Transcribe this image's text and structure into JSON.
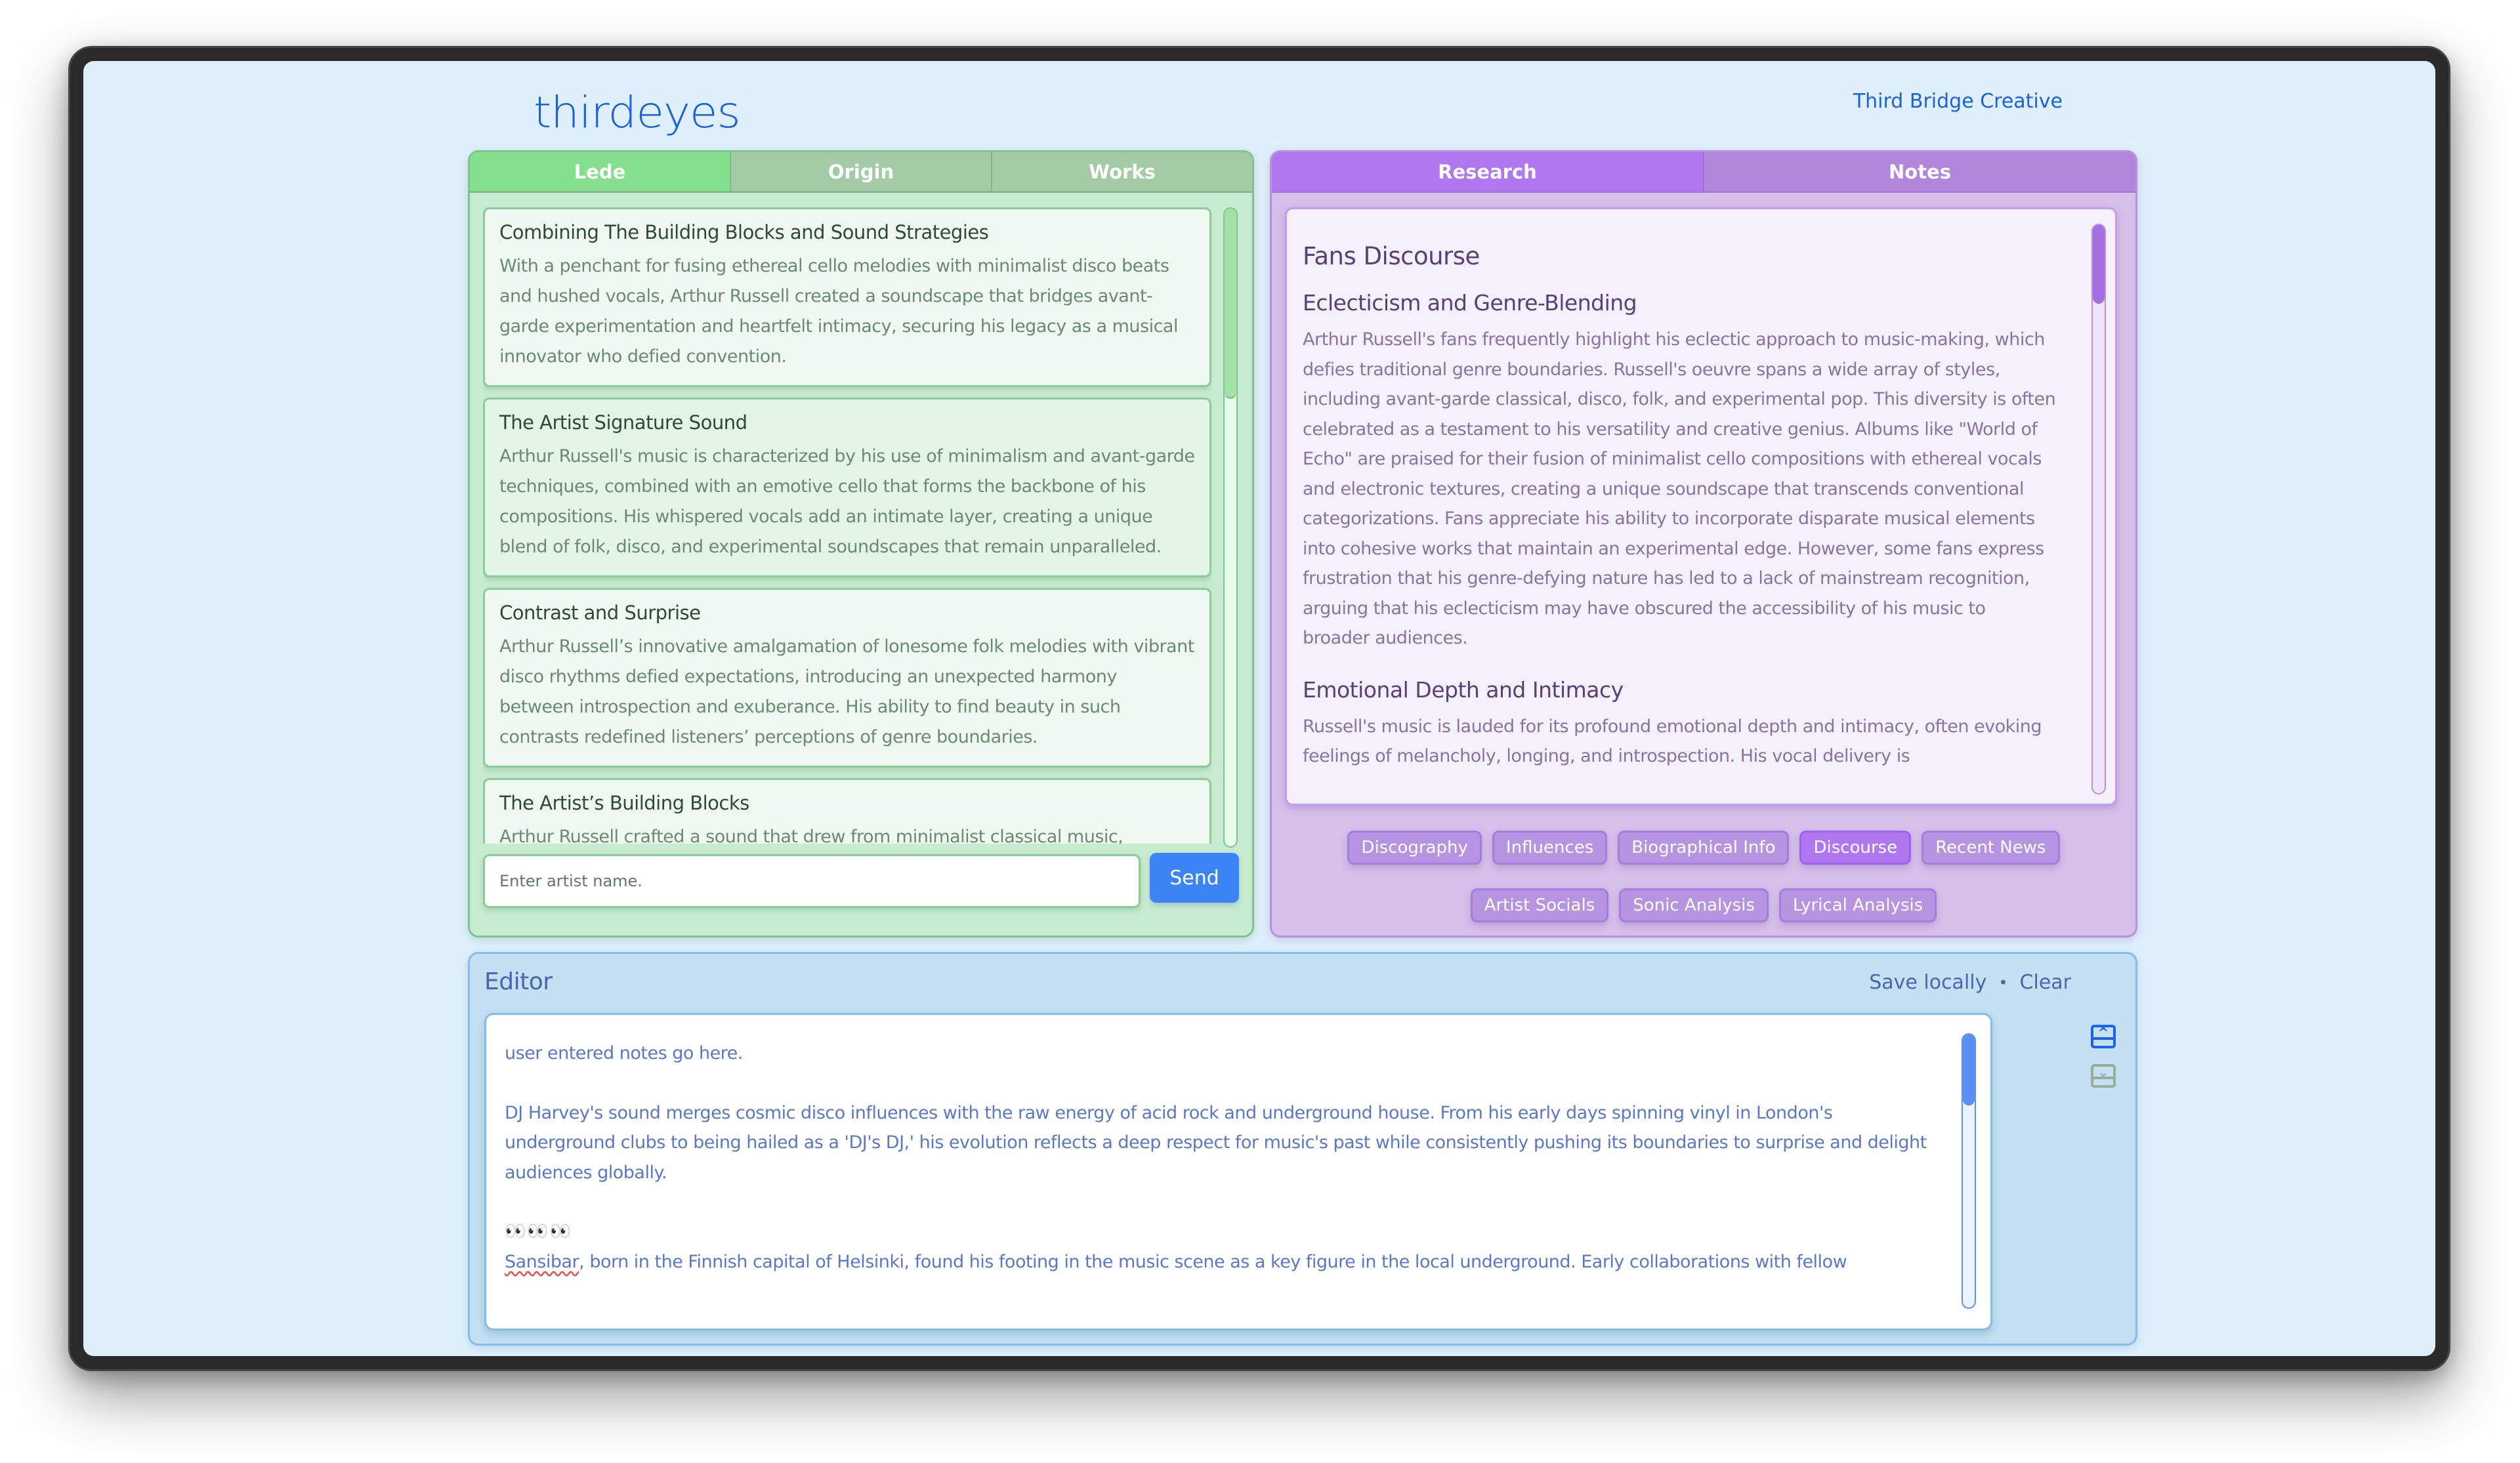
{
  "header": {
    "logo": "thirdeyes",
    "brand_link": "Third Bridge Creative"
  },
  "left_panel": {
    "tabs": [
      {
        "label": "Lede",
        "active": true
      },
      {
        "label": "Origin",
        "active": false
      },
      {
        "label": "Works",
        "active": false
      }
    ],
    "cards": [
      {
        "title": "Combining The Building Blocks and Sound Strategies",
        "body": "With a penchant for fusing ethereal cello melodies with minimalist disco beats and hushed vocals, Arthur Russell created a soundscape that bridges avant-garde experimentation and heartfelt intimacy, securing his legacy as a musical innovator who defied convention."
      },
      {
        "title": "The Artist Signature Sound",
        "body": "Arthur Russell's music is characterized by his use of minimalism and avant-garde techniques, combined with an emotive cello that forms the backbone of his compositions. His whispered vocals add an intimate layer, creating a unique blend of folk, disco, and experimental soundscapes that remain unparalleled."
      },
      {
        "title": "Contrast and Surprise",
        "body": "Arthur Russell’s innovative amalgamation of lonesome folk melodies with vibrant disco rhythms defied expectations, introducing an unexpected harmony between introspection and exuberance. His ability to find beauty in such contrasts redefined listeners’ perceptions of genre boundaries."
      },
      {
        "title": "The Artist’s Building Blocks",
        "body": "Arthur Russell crafted a sound that drew from minimalist classical music,"
      }
    ],
    "input": {
      "placeholder": "Enter artist name.",
      "value": ""
    },
    "send_label": "Send",
    "scroll_position": 0.0
  },
  "right_panel": {
    "tabs": [
      {
        "label": "Research",
        "active": true
      },
      {
        "label": "Notes",
        "active": false
      }
    ],
    "research": {
      "heading": "Fans Discourse",
      "sections": [
        {
          "title": "Eclecticism and Genre-Blending",
          "body": "Arthur Russell's fans frequently highlight his eclectic approach to music-making, which defies traditional genre boundaries. Russell's oeuvre spans a wide array of styles, including avant-garde classical, disco, folk, and experimental pop. This diversity is often celebrated as a testament to his versatility and creative genius. Albums like \"World of Echo\" are praised for their fusion of minimalist cello compositions with ethereal vocals and electronic textures, creating a unique soundscape that transcends conventional categorizations. Fans appreciate his ability to incorporate disparate musical elements into cohesive works that maintain an experimental edge. However, some fans express frustration that his genre-defying nature has led to a lack of mainstream recognition, arguing that his eclecticism may have obscured the accessibility of his music to broader audiences."
        },
        {
          "title": "Emotional Depth and Intimacy",
          "body": "Russell's music is lauded for its profound emotional depth and intimacy, often evoking feelings of melancholy, longing, and introspection. His vocal delivery is"
        }
      ]
    },
    "chips_row1": [
      {
        "label": "Discography",
        "active": false
      },
      {
        "label": "Influences",
        "active": false
      },
      {
        "label": "Biographical Info",
        "active": false
      },
      {
        "label": "Discourse",
        "active": true
      },
      {
        "label": "Recent News",
        "active": false
      }
    ],
    "chips_row2": [
      {
        "label": "Artist Socials",
        "active": false
      },
      {
        "label": "Sonic Analysis",
        "active": false
      },
      {
        "label": "Lyrical Analysis",
        "active": false
      }
    ]
  },
  "editor": {
    "title": "Editor",
    "save_label": "Save locally",
    "separator": "•",
    "clear_label": "Clear",
    "paragraphs": [
      "user entered notes go here.",
      "DJ Harvey's sound merges cosmic disco influences with the raw energy of acid rock and underground house. From his early days spinning vinyl in London's underground clubs to being hailed as a 'DJ's DJ,' his evolution reflects a deep respect for music's past while consistently pushing its boundaries to surprise and delight audiences globally."
    ],
    "emoji_row": "👀👀👀",
    "last_paragraph_misspelled": "Sansibar",
    "last_paragraph_rest": ", born in the Finnish capital of Helsinki, found his footing in the music scene as a key figure in the local underground. Early collaborations with fellow",
    "scroll_top_label": "scroll to top",
    "scroll_bottom_label": "scroll to bottom"
  },
  "colors": {
    "brand_blue": "#1a62e0",
    "green_tab_active": "#84e08c",
    "purple_tab_active": "#b077f0",
    "send_button": "#3c84f5",
    "editor_text": "#5a78c6"
  }
}
